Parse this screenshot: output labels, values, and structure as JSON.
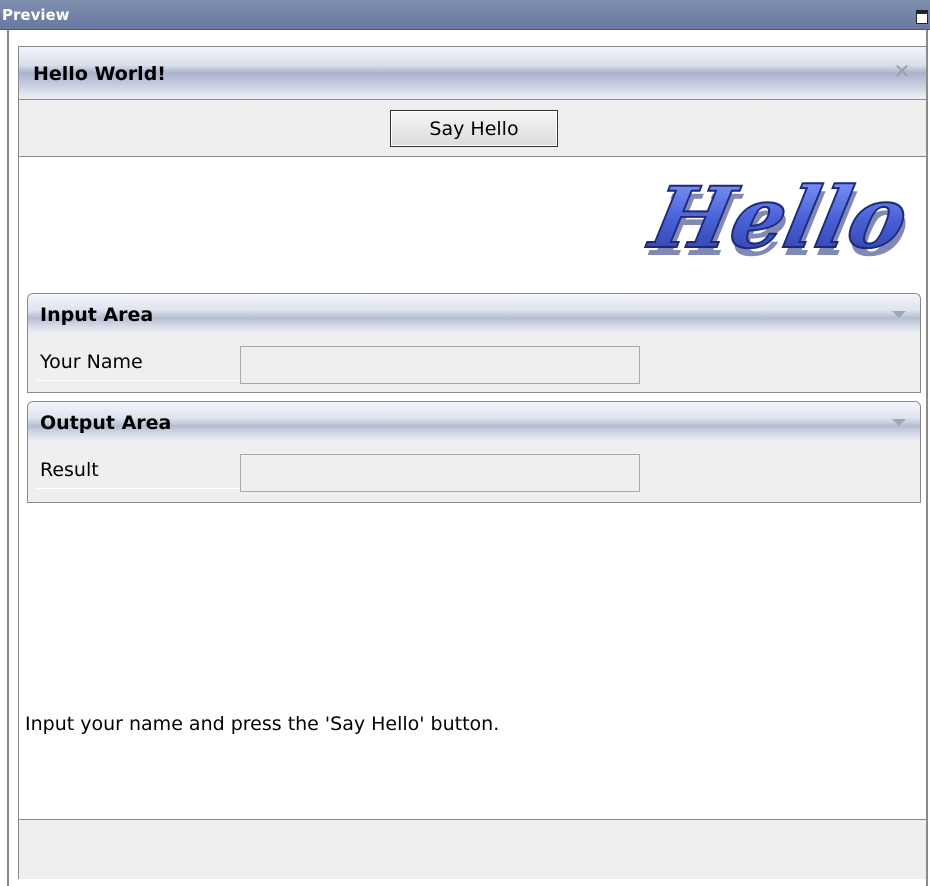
{
  "preview": {
    "title": "Preview",
    "maximize_icon": "maximize-icon"
  },
  "app": {
    "title": "Hello World!",
    "close_icon": "close-icon",
    "say_hello_label": "Say Hello",
    "logo_text": "Hello",
    "logo_color": "#4a62d8"
  },
  "input_area": {
    "title": "Input Area",
    "name_label": "Your Name",
    "name_value": "",
    "collapse_icon": "triangle-down-icon"
  },
  "output_area": {
    "title": "Output Area",
    "result_label": "Result",
    "result_value": "",
    "collapse_icon": "triangle-down-icon"
  },
  "status": {
    "message": "Input your name and press the 'Say Hello' button."
  }
}
